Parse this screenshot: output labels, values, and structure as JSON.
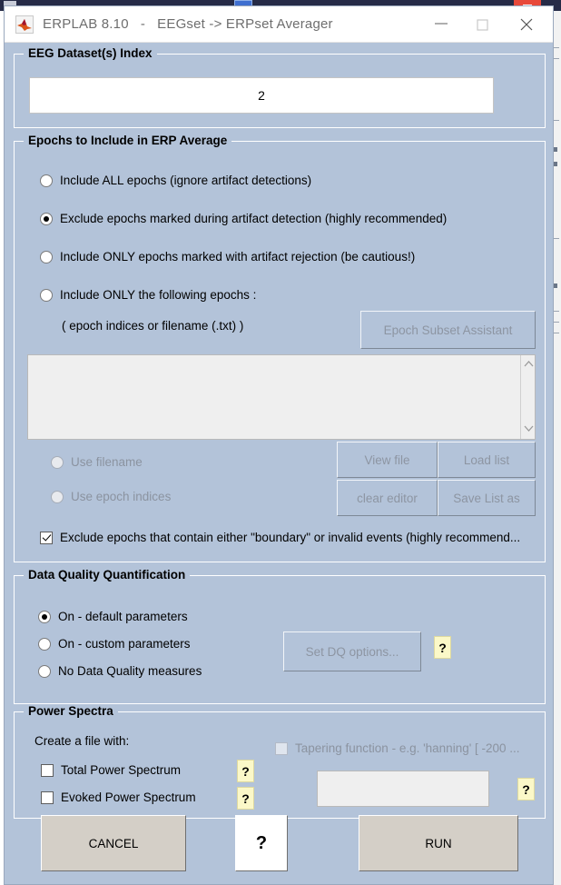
{
  "background_window": {
    "icon": "blue-app-icon",
    "close_icon": "close-icon"
  },
  "titlebar": {
    "app_icon": "matlab-icon",
    "title": "ERPLAB 8.10   -   EEGset -> ERPset Averager",
    "minimize_icon": "minimize-icon",
    "maximize_icon": "maximize-icon",
    "close_icon": "close-icon"
  },
  "dataset_index": {
    "group_title": "EEG Dataset(s) Index",
    "value": "2"
  },
  "epochs": {
    "group_title": "Epochs to Include in ERP Average",
    "options": [
      {
        "label": "Include ALL epochs (ignore artifact detections)",
        "selected": false
      },
      {
        "label": "Exclude epochs marked during artifact detection (highly recommended)",
        "selected": true
      },
      {
        "label": "Include ONLY epochs marked with artifact rejection (be cautious!)",
        "selected": false
      },
      {
        "label": "Include ONLY the following epochs  :",
        "selected": false
      }
    ],
    "hint": "( epoch indices or filename (.txt) )",
    "assistant_button": "Epoch Subset Assistant",
    "editor_value": "",
    "scroll_up_icon": "chevron-up-icon",
    "scroll_down_icon": "chevron-down-icon",
    "source_options": [
      {
        "label": "Use filename",
        "selected": false
      },
      {
        "label": "Use epoch indices",
        "selected": false
      }
    ],
    "file_buttons": [
      "View file",
      "Load list",
      "clear editor",
      "Save List as"
    ],
    "boundary_checkbox": {
      "label": "Exclude epochs that contain either \"boundary\" or invalid events (highly recommend...",
      "checked": true
    }
  },
  "data_quality": {
    "group_title": "Data Quality Quantification",
    "options": [
      {
        "label": "On - default parameters",
        "selected": true
      },
      {
        "label": "On - custom parameters",
        "selected": false
      },
      {
        "label": "No Data Quality measures",
        "selected": false
      }
    ],
    "set_options_button": "Set DQ options...",
    "help_badge": "?"
  },
  "power_spectra": {
    "group_title": "Power Spectra",
    "create_label": "Create a file with:",
    "checkboxes": [
      {
        "label": "Total Power Spectrum",
        "checked": false,
        "help": "?"
      },
      {
        "label": "Evoked Power Spectrum",
        "checked": false,
        "help": "?"
      }
    ],
    "tapering": {
      "label": "Tapering function - e.g.  'hanning'  [ -200  ...",
      "checked": false,
      "field_value": "",
      "help": "?"
    }
  },
  "footer": {
    "cancel": "CANCEL",
    "help": "?",
    "run": "RUN"
  },
  "colors": {
    "panel": "#b3c3d9",
    "titlebar": "#ffffff",
    "button": "#d4cfc7",
    "help_badge": "#fbf8c8",
    "bg_window": "#262b47",
    "bg_close": "#e8493a"
  }
}
